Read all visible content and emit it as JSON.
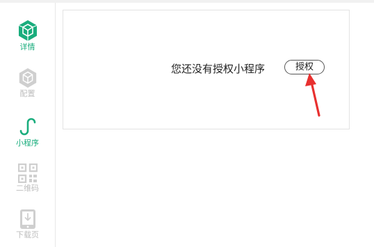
{
  "sidebar": {
    "items": [
      {
        "label": "详情",
        "icon": "cube-icon",
        "active": true
      },
      {
        "label": "配置",
        "icon": "cube-outline-icon",
        "active": false
      },
      {
        "label": "小程序",
        "icon": "miniprogram-icon",
        "active": true
      },
      {
        "label": "二维码",
        "icon": "qrcode-icon",
        "active": false
      },
      {
        "label": "下载页",
        "icon": "download-page-icon",
        "active": false
      }
    ]
  },
  "main": {
    "message": "您还没有授权小程序",
    "auth_button_label": "授权"
  },
  "colors": {
    "accent": "#1aad7d",
    "inactive": "#bdbdbd",
    "arrow": "#e8302f"
  }
}
